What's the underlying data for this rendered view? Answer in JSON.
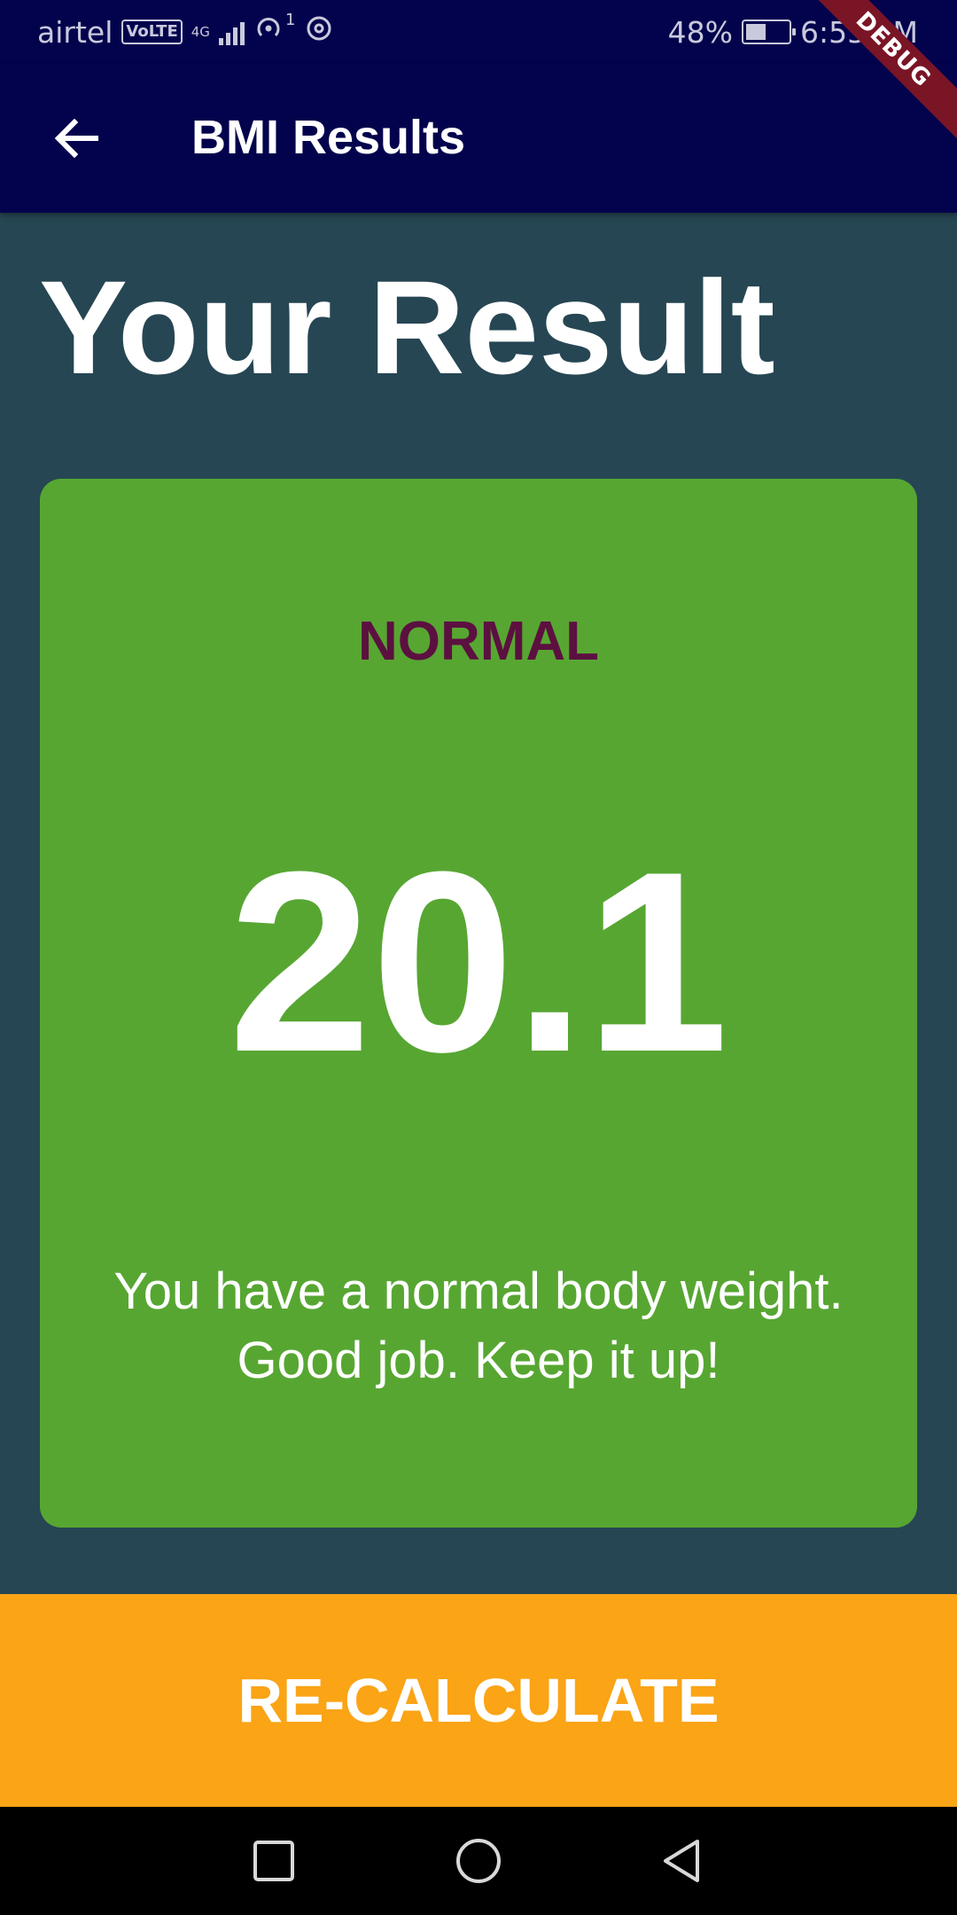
{
  "status_bar": {
    "carrier": "airtel",
    "volte": "VoLTE",
    "network": "4G",
    "hotspot_count": "1",
    "battery_percent": "48%",
    "battery_level": 0.48,
    "time": "6:55 PM"
  },
  "debug_banner": "DEBUG",
  "app_bar": {
    "title": "BMI Results",
    "back_icon": "arrow-back-icon"
  },
  "heading": "Your Result",
  "result": {
    "category": "NORMAL",
    "bmi": "20.1",
    "message": "You have a normal body weight. Good job. Keep it up!"
  },
  "button": {
    "label": "RE-CALCULATE"
  },
  "nav_bar": {
    "icons": [
      "square-recents-icon",
      "circle-home-icon",
      "triangle-back-icon"
    ]
  },
  "colors": {
    "app_bar": "#03034d",
    "background": "#264653",
    "card": "#57a632",
    "category_text": "#5c1040",
    "button": "#faa416"
  }
}
